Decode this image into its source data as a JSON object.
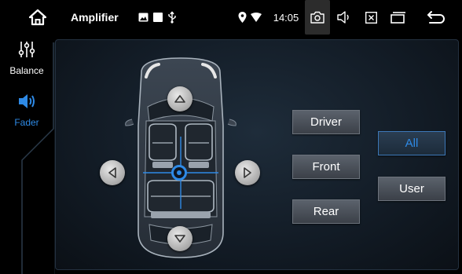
{
  "statusbar": {
    "home_icon": "home-icon",
    "title": "Amplifier",
    "time": "14:05",
    "icons": [
      "image-icon",
      "square-icon",
      "usb-icon",
      "location-icon",
      "wifi-icon",
      "camera-icon",
      "volume-icon",
      "close-box-icon",
      "recent-apps-icon",
      "back-icon"
    ]
  },
  "sidebar": {
    "items": [
      {
        "label": "Balance",
        "icon": "equalizer-icon",
        "active": false
      },
      {
        "label": "Fader",
        "icon": "speaker-icon",
        "active": true
      }
    ]
  },
  "main": {
    "arrows": [
      "arrow-up-icon",
      "arrow-down-icon",
      "arrow-left-icon",
      "arrow-right-icon"
    ],
    "buttons": {
      "driver": "Driver",
      "front": "Front",
      "rear": "Rear",
      "all": "All",
      "user": "User"
    },
    "selected_mode": "All"
  },
  "colors": {
    "accent": "#2e8ae6",
    "active_text": "#2e8ae6",
    "background": "#000000",
    "panel": "#151f2a"
  }
}
